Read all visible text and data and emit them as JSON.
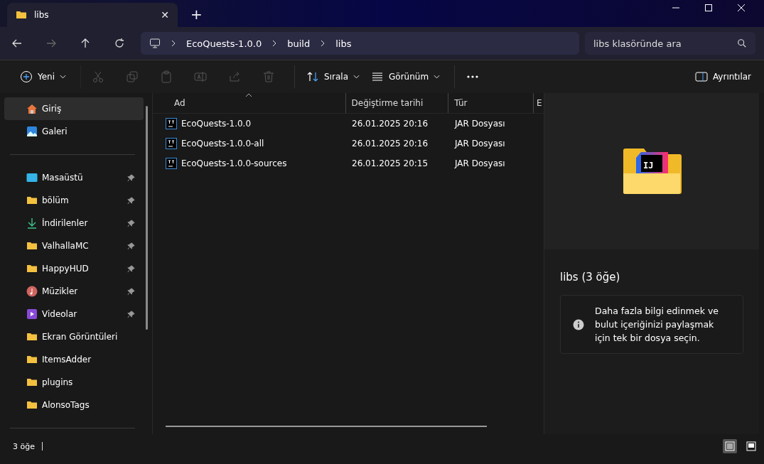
{
  "tab": {
    "title": "libs",
    "close": "✕",
    "new_tab": "+"
  },
  "breadcrumbs": [
    "EcoQuests-1.0.0",
    "build",
    "libs"
  ],
  "search": {
    "placeholder": "libs klasöründe ara"
  },
  "toolbar": [
    {
      "kind": "new",
      "label": "Yeni",
      "disabled": false
    },
    {
      "kind": "cut",
      "disabled": true
    },
    {
      "kind": "copy",
      "disabled": true
    },
    {
      "kind": "paste",
      "disabled": true
    },
    {
      "kind": "rename",
      "disabled": true
    },
    {
      "kind": "share",
      "disabled": true
    },
    {
      "kind": "delete",
      "disabled": true
    },
    {
      "kind": "sort",
      "label": "Sırala",
      "disabled": false
    },
    {
      "kind": "view",
      "label": "Görünüm",
      "disabled": false
    },
    {
      "kind": "more",
      "disabled": false
    }
  ],
  "details_button": {
    "label": "Ayrıntılar"
  },
  "sidebar": {
    "groups": [
      [
        {
          "label": "Giriş",
          "kind": "home",
          "pinned": false,
          "selected": true
        },
        {
          "label": "Galeri",
          "kind": "gallery",
          "pinned": false,
          "selected": false
        }
      ],
      [
        {
          "label": "Masaüstü",
          "kind": "desktop",
          "pinned": true,
          "selected": false
        },
        {
          "label": "bölüm",
          "kind": "folder",
          "pinned": true,
          "selected": false
        },
        {
          "label": "İndirilenler",
          "kind": "download",
          "pinned": true,
          "selected": false
        },
        {
          "label": "ValhallaMC",
          "kind": "folder",
          "pinned": true,
          "selected": false
        },
        {
          "label": "HappyHUD",
          "kind": "folder",
          "pinned": true,
          "selected": false
        },
        {
          "label": "Müzikler",
          "kind": "music",
          "pinned": true,
          "selected": false
        },
        {
          "label": "Videolar",
          "kind": "video",
          "pinned": true,
          "selected": false
        },
        {
          "label": "Ekran Görüntüleri",
          "kind": "folder",
          "pinned": false,
          "selected": false
        },
        {
          "label": "ItemsAdder",
          "kind": "folder",
          "pinned": false,
          "selected": false
        },
        {
          "label": "plugins",
          "kind": "folder",
          "pinned": false,
          "selected": false
        },
        {
          "label": "AlonsoTags",
          "kind": "folder",
          "pinned": false,
          "selected": false
        }
      ]
    ]
  },
  "table": {
    "columns": [
      {
        "label": "Ad",
        "sorted": true
      },
      {
        "label": "Değiştirme tarihi",
        "sorted": false
      },
      {
        "label": "Tür",
        "sorted": false
      },
      {
        "label": "E",
        "sorted": false
      }
    ],
    "rows": [
      {
        "name": "EcoQuests-1.0.0",
        "date": "26.01.2025 20:16",
        "type": "JAR Dosyası"
      },
      {
        "name": "EcoQuests-1.0.0-all",
        "date": "26.01.2025 20:16",
        "type": "JAR Dosyası"
      },
      {
        "name": "EcoQuests-1.0.0-sources",
        "date": "26.01.2025 20:15",
        "type": "JAR Dosyası"
      }
    ]
  },
  "details": {
    "title": "libs (3 öğe)",
    "info": "Daha fazla bilgi edinmek ve bulut içeriğinizi paylaşmak için tek bir dosya seçin.",
    "folder_badge": "IJ"
  },
  "status_bar": {
    "count": "3 öğe",
    "views": [
      {
        "kind": "details",
        "selected": true
      },
      {
        "kind": "tiles",
        "selected": false
      }
    ]
  }
}
